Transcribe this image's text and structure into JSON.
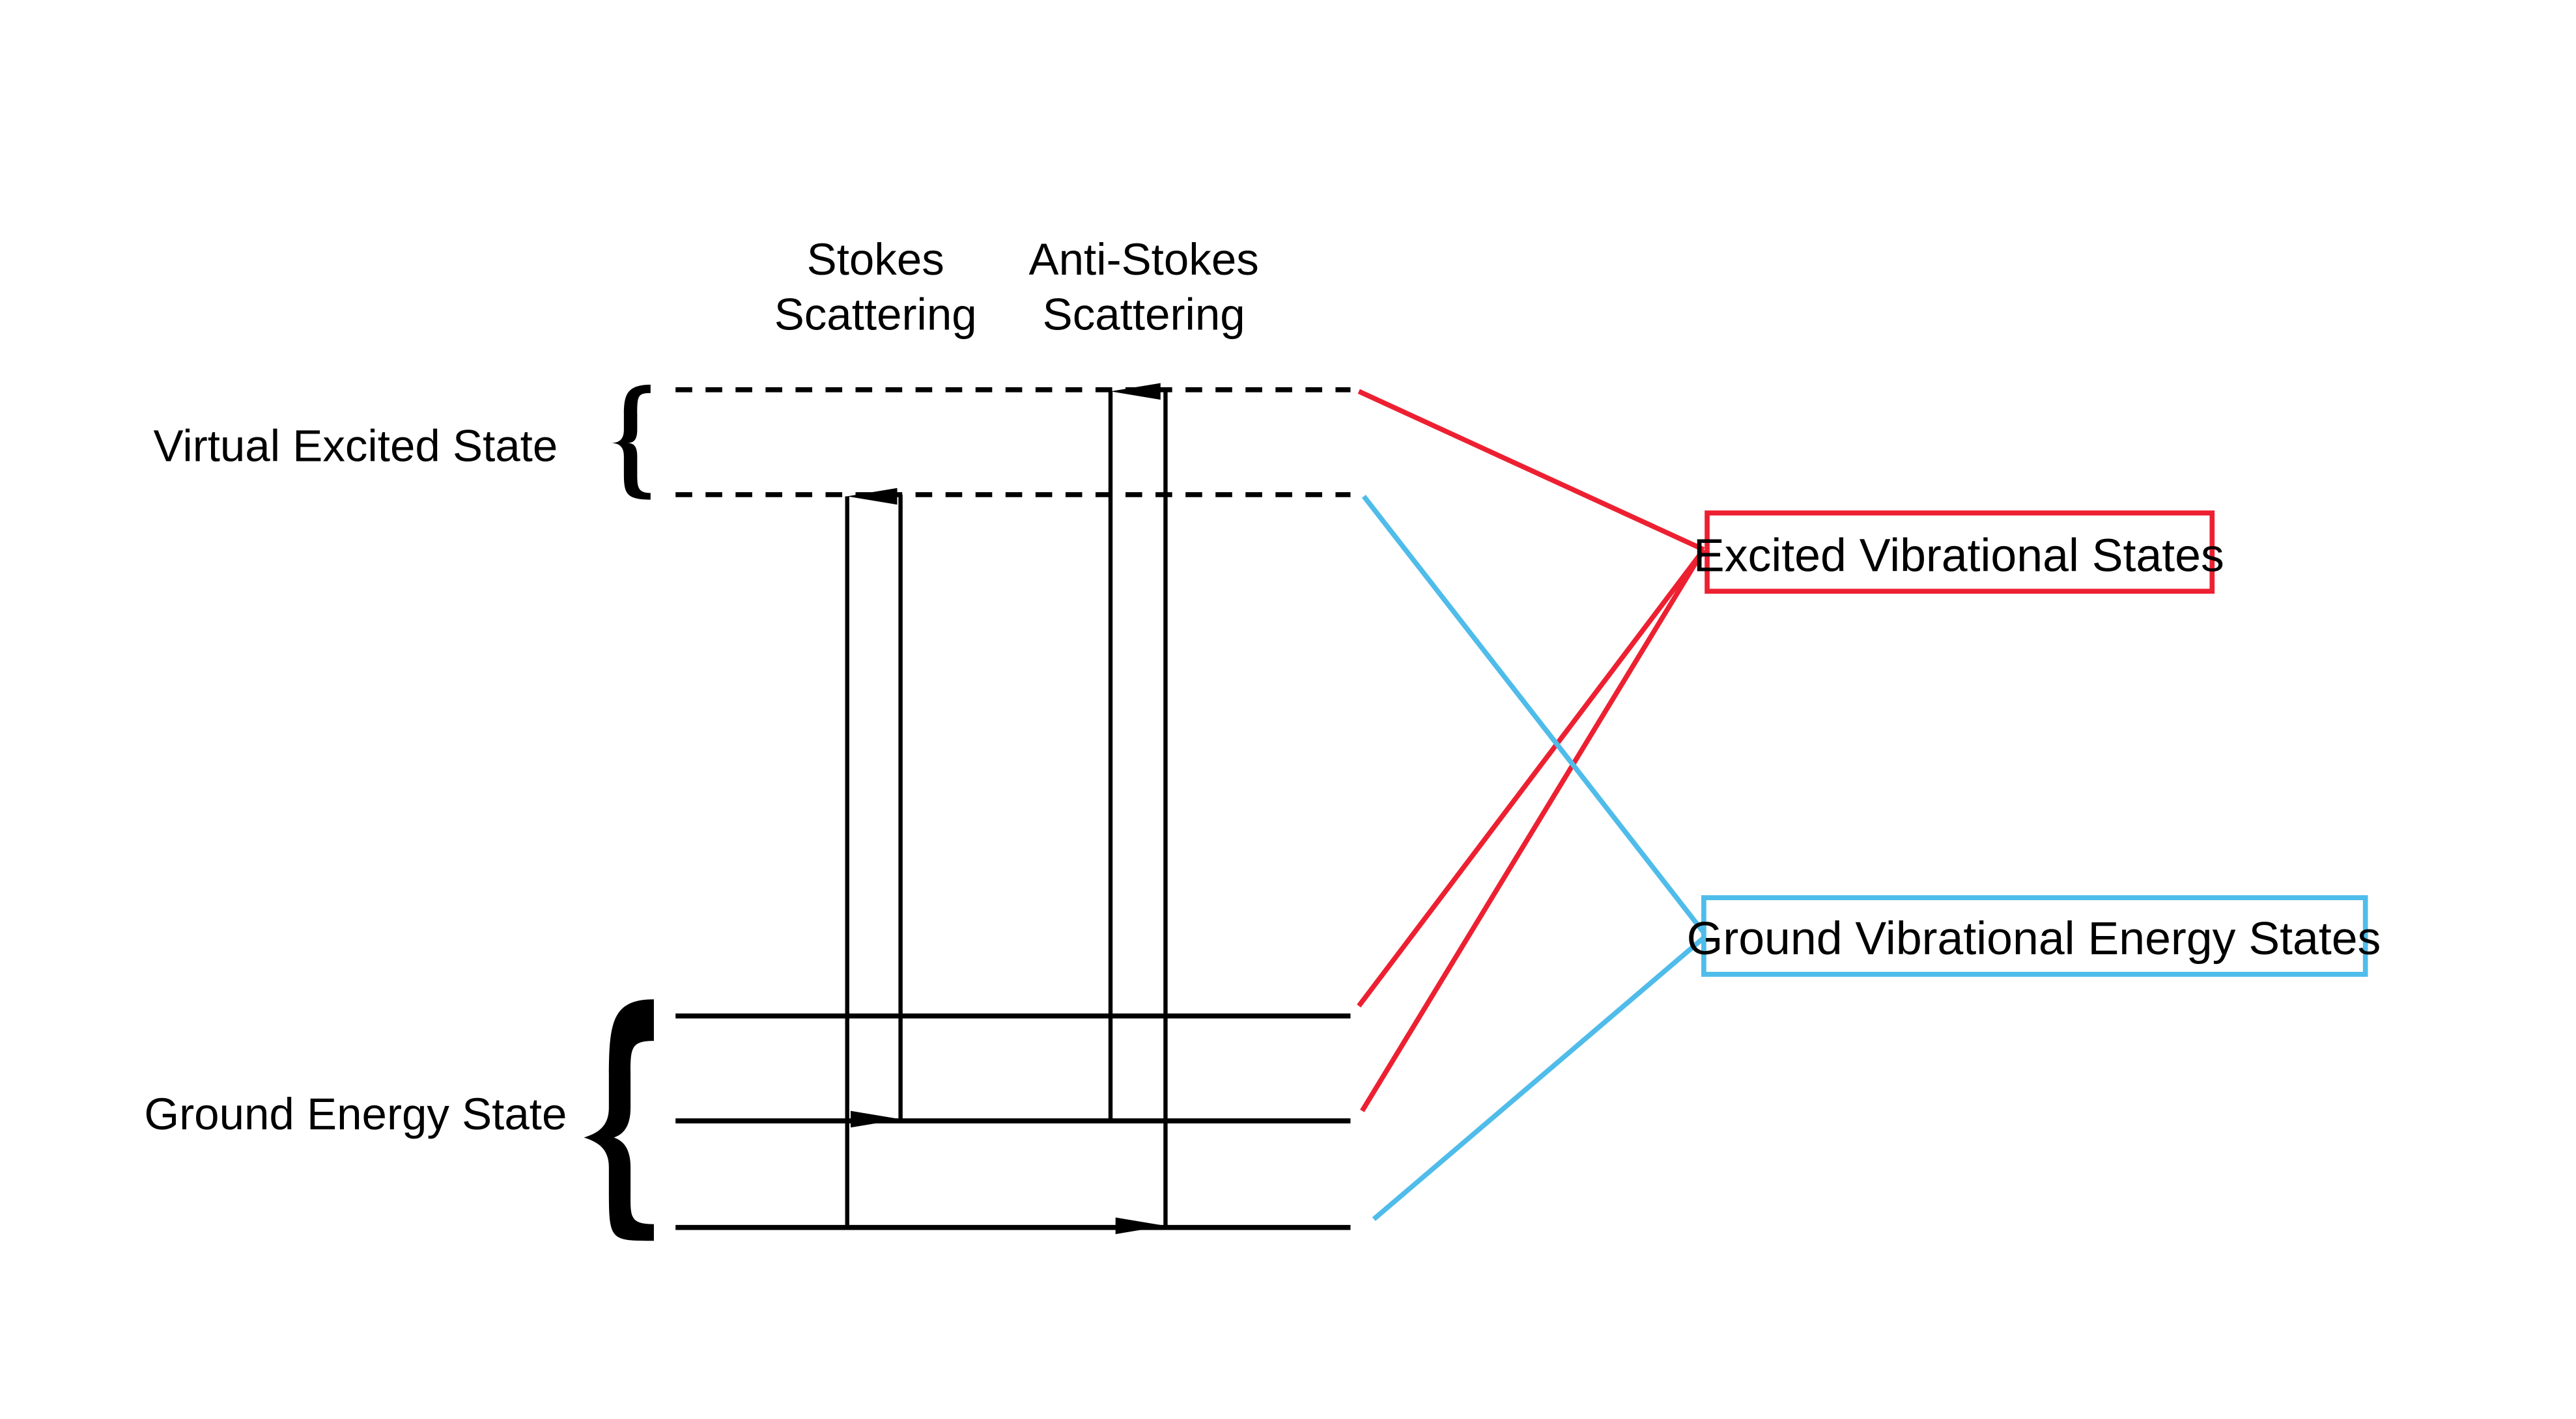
{
  "diagram": {
    "title_stokes": [
      "Stokes",
      "Scattering"
    ],
    "title_anti_stokes": [
      "Anti-Stokes",
      "Scattering"
    ],
    "virtual_label": "Virtual Excited State",
    "ground_label": "Ground Energy State",
    "excited_box_label": "Excited Vibrational States",
    "ground_box_label": "Ground Vibrational Energy States",
    "colors": {
      "excited": "#ED2031",
      "ground": "#4FBCEA",
      "line": "#000000"
    },
    "levels": {
      "virtual": [
        "virtual-upper",
        "virtual-lower"
      ],
      "ground": [
        "ground-v2",
        "ground-v1",
        "ground-v0"
      ]
    },
    "transitions": [
      {
        "name": "stokes-excitation",
        "from": "ground-v0",
        "to": "virtual-lower",
        "direction": "up"
      },
      {
        "name": "stokes-emission",
        "from": "virtual-lower",
        "to": "ground-v1",
        "direction": "down"
      },
      {
        "name": "anti-stokes-excitation",
        "from": "ground-v1",
        "to": "virtual-upper",
        "direction": "up"
      },
      {
        "name": "anti-stokes-emission",
        "from": "virtual-upper",
        "to": "ground-v0",
        "direction": "down"
      }
    ]
  }
}
